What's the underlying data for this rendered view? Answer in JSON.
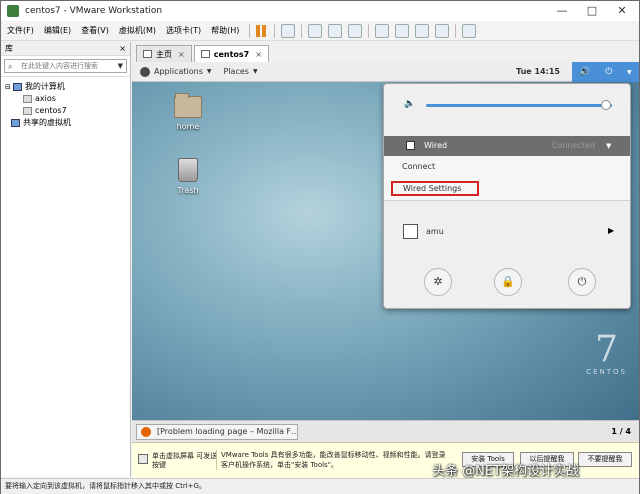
{
  "window": {
    "title": "centos7 - VMware Workstation"
  },
  "menubar": {
    "items": [
      "文件(F)",
      "编辑(E)",
      "查看(V)",
      "虚拟机(M)",
      "选项卡(T)",
      "帮助(H)"
    ]
  },
  "library": {
    "header": "库",
    "close_glyph": "×",
    "search_placeholder": "在此处键入内容进行搜索",
    "tree": {
      "my_computer": "我的计算机",
      "vms": [
        "axios",
        "centos7"
      ],
      "shared": "共享的虚拟机"
    }
  },
  "tabs": [
    {
      "label": "主页"
    },
    {
      "label": "centos7"
    }
  ],
  "gnome": {
    "applications": "Applications",
    "places": "Places",
    "clock": "Tue 14:15",
    "volume_fraction": 0.97,
    "wired": {
      "label": "Wired",
      "status": "Connected"
    },
    "connect": "Connect",
    "wired_settings": "Wired Settings",
    "user": "amu",
    "desktop_icons": {
      "home": "home",
      "trash": "Trash"
    },
    "distro": {
      "version": "7",
      "name": "CENTOS"
    },
    "task": "[Problem loading page – Mozilla F…",
    "pager": "1 / 4"
  },
  "hint": {
    "tip": "单击虚拟屏幕 可发送按键",
    "message": "VMware Tools 具有很多功能，能改善鼠标移动性、视频和性能。请登录客户机操作系统，单击\"安装 Tools\"。",
    "buttons": [
      "安装 Tools",
      "以后提醒我",
      "不要提醒我"
    ],
    "watermark": "头条 @NET架构设计实战"
  },
  "status": "要将输入定向到该虚拟机，请将鼠标指针移入其中或按 Ctrl+G。",
  "colors": {
    "accent": "#4a90d9",
    "highlight_border": "#d42222"
  }
}
